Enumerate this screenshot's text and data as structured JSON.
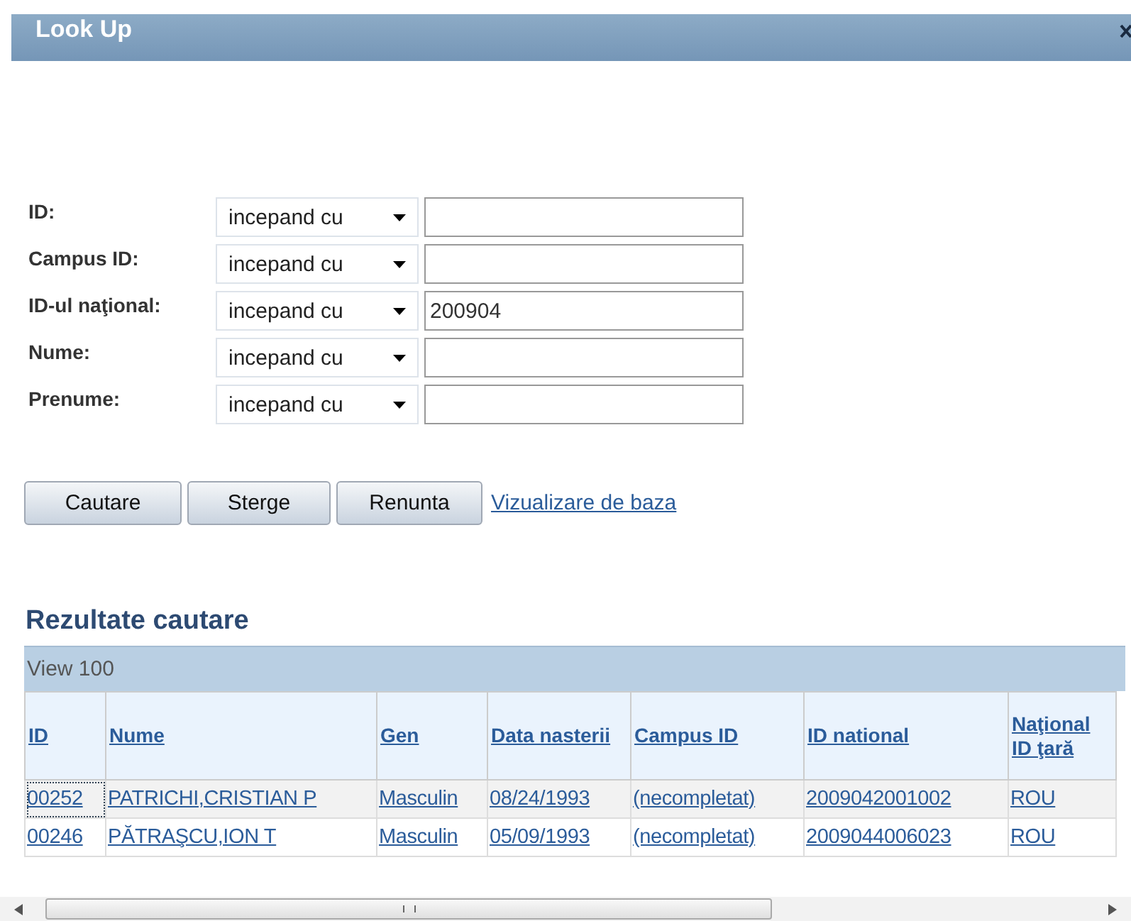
{
  "window": {
    "title": "Look Up"
  },
  "fields": [
    {
      "label": "ID:",
      "operator": "incepand cu"
    },
    {
      "label": "Campus ID:",
      "operator": "incepand cu"
    },
    {
      "label": "ID-ul naţional:",
      "operator": "incepand cu",
      "value": "200904"
    },
    {
      "label": "Nume:",
      "operator": "incepand cu"
    },
    {
      "label": "Prenume:",
      "operator": "incepand cu"
    }
  ],
  "buttons": [
    "Cautare",
    "Sterge",
    "Renunta"
  ],
  "link": "Vizualizare de baza",
  "results": {
    "title": "Rezultate cautare",
    "view": "View 100",
    "columns": [
      "ID",
      "Nume",
      "Gen",
      "Data nasterii",
      "Campus ID",
      "ID national",
      "Naţional ID ţară"
    ],
    "rows": [
      {
        "selected": true,
        "cells": [
          "00252",
          "PATRICHI,CRISTIAN P",
          "Masculin",
          "08/24/1993",
          "(necompletat)",
          "2009042001002",
          "ROU"
        ]
      },
      {
        "selected": false,
        "cells": [
          "00246",
          "PĂTRAŞCU,ION T",
          "Masculin",
          "05/09/1993",
          "(necompletat)",
          "2009044006023",
          "ROU"
        ]
      }
    ]
  }
}
